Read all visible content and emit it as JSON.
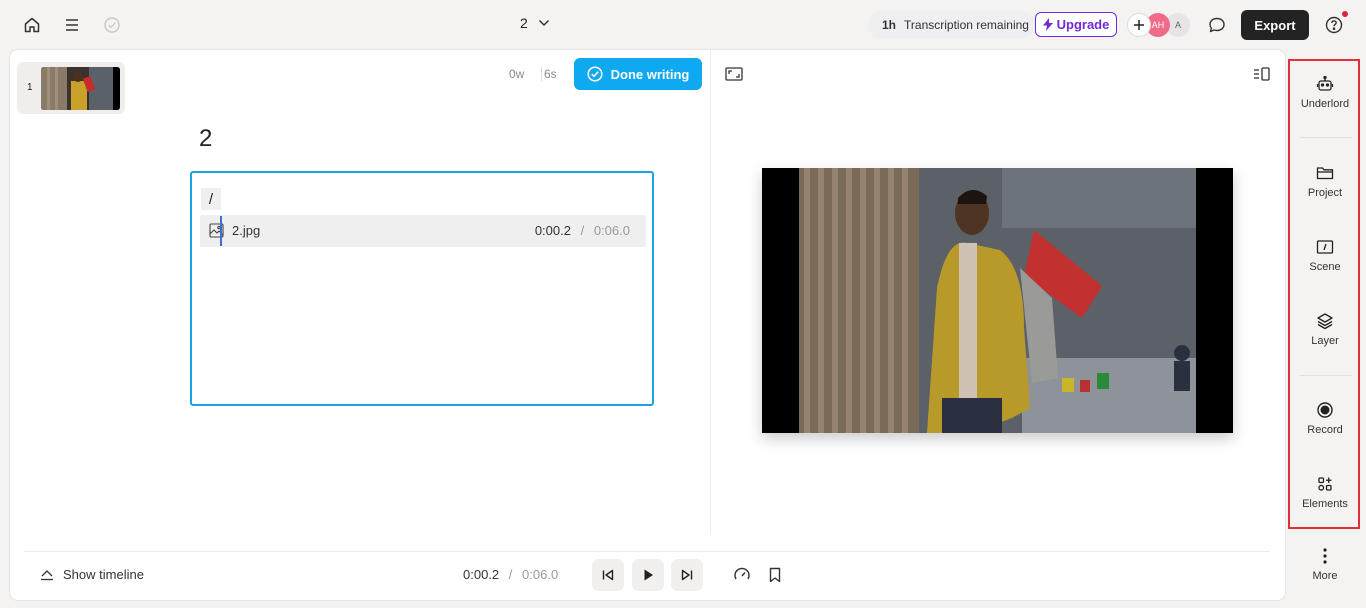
{
  "topbar": {
    "project_title": "2",
    "transcription_amount": "1h",
    "transcription_label": "Transcription remaining",
    "upgrade_label": "Upgrade",
    "avatar_1_initials": "AH",
    "avatar_2_initials": "A",
    "export_label": "Export"
  },
  "script": {
    "thumbnail_number": "1",
    "word_count": "0w",
    "duration": "6s",
    "done_label": "Done writing",
    "scene_title": "2",
    "slash": "/",
    "media": {
      "name": "2.jpg",
      "current": "0:00.2",
      "separator": "/",
      "total": "0:06.0"
    }
  },
  "playback": {
    "show_timeline_label": "Show timeline",
    "current": "0:00.2",
    "separator": "/",
    "total": "0:06.0"
  },
  "sidebar": {
    "items": [
      {
        "label": "Underlord",
        "icon": "robot-icon"
      },
      {
        "label": "Project",
        "icon": "folder-icon"
      },
      {
        "label": "Scene",
        "icon": "scene-icon"
      },
      {
        "label": "Layer",
        "icon": "layers-icon"
      },
      {
        "label": "Record",
        "icon": "record-icon"
      },
      {
        "label": "Elements",
        "icon": "elements-icon"
      },
      {
        "label": "More",
        "icon": "more-icon"
      }
    ]
  },
  "colors": {
    "accent_blue": "#0fa9f2",
    "upgrade_purple": "#6f2bd8",
    "highlight_red": "#e0313b",
    "export_dark": "#232323"
  }
}
